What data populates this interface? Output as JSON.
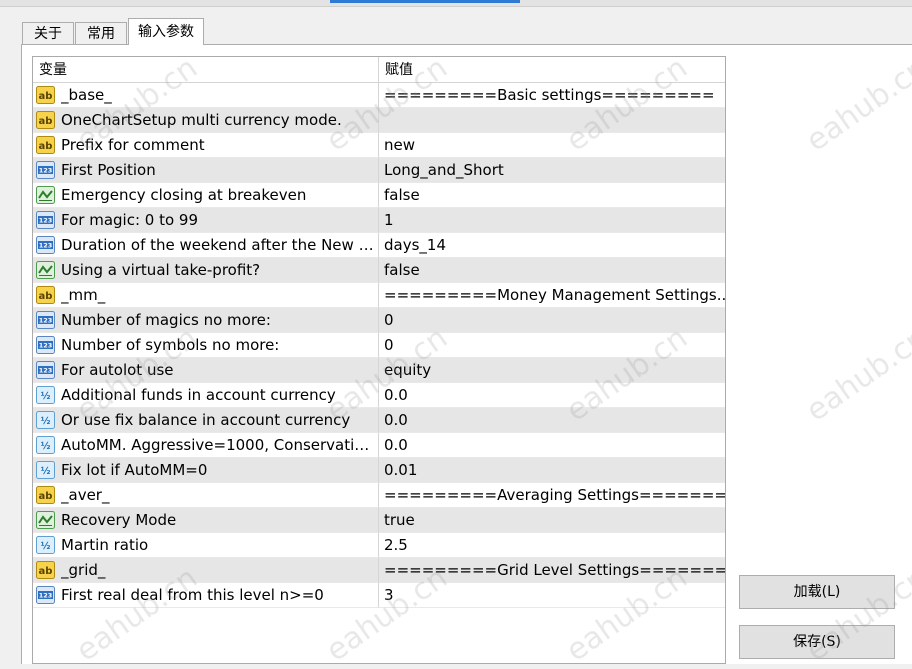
{
  "tabs": [
    {
      "label": "关于",
      "active": false
    },
    {
      "label": "常用",
      "active": false
    },
    {
      "label": "输入参数",
      "active": true
    }
  ],
  "table": {
    "columns": {
      "variable": "变量",
      "value": "赋值"
    },
    "rows": [
      {
        "icon": "ab",
        "name": "_base_",
        "value": "=========Basic settings========="
      },
      {
        "icon": "ab",
        "name": "OneChartSetup multi currency mode.",
        "value": ""
      },
      {
        "icon": "ab",
        "name": "Prefix for comment",
        "value": "new"
      },
      {
        "icon": "123",
        "name": "First Position",
        "value": "Long_and_Short"
      },
      {
        "icon": "bool",
        "name": "Emergency closing at breakeven",
        "value": "false"
      },
      {
        "icon": "123",
        "name": "For magic: 0 to 99",
        "value": "1"
      },
      {
        "icon": "123",
        "name": "Duration of the weekend after the New Y...",
        "value": "days_14"
      },
      {
        "icon": "bool",
        "name": "Using a virtual take-profit?",
        "value": "false"
      },
      {
        "icon": "ab",
        "name": "_mm_",
        "value": "=========Money Management Settings..."
      },
      {
        "icon": "123",
        "name": "Number of magics no more:",
        "value": "0"
      },
      {
        "icon": "123",
        "name": "Number of symbols no more:",
        "value": "0"
      },
      {
        "icon": "123",
        "name": "For autolot use",
        "value": "equity"
      },
      {
        "icon": "half",
        "name": "Additional funds in account currency",
        "value": "0.0"
      },
      {
        "icon": "half",
        "name": "Or use fix balance in account currency",
        "value": "0.0"
      },
      {
        "icon": "half",
        "name": "AutoMM. Aggressive=1000, Conservativ...",
        "value": "0.0"
      },
      {
        "icon": "half",
        "name": "Fix lot if AutoMM=0",
        "value": "0.01"
      },
      {
        "icon": "ab",
        "name": "_aver_",
        "value": "=========Averaging Settings========="
      },
      {
        "icon": "bool",
        "name": "Recovery Mode",
        "value": "true"
      },
      {
        "icon": "half",
        "name": "Martin ratio",
        "value": "2.5"
      },
      {
        "icon": "ab",
        "name": "_grid_",
        "value": "=========Grid Level Settings========="
      },
      {
        "icon": "123",
        "name": "First real deal from this level n>=0",
        "value": "3"
      }
    ]
  },
  "buttons": {
    "load": "加载(L)",
    "save": "保存(S)"
  },
  "watermark": "eahub.cn",
  "colors": {
    "ab_icon": "#f0c419",
    "int_icon": "#2f6fc0",
    "bool_icon": "#3a9a3a",
    "double_icon": "#5fa8d8"
  }
}
